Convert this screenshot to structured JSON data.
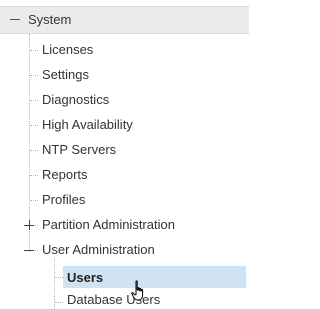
{
  "tree": {
    "root": {
      "label": "System",
      "expanded": true
    },
    "items": [
      {
        "label": "Licenses"
      },
      {
        "label": "Settings"
      },
      {
        "label": "Diagnostics"
      },
      {
        "label": "High Availability"
      },
      {
        "label": "NTP Servers"
      },
      {
        "label": "Reports"
      },
      {
        "label": "Profiles"
      },
      {
        "label": "Partition Administration",
        "expanded": false
      },
      {
        "label": "User Administration",
        "expanded": true
      }
    ],
    "sub_items": [
      {
        "label": "Users",
        "selected": true
      },
      {
        "label": "Database Users"
      }
    ]
  },
  "colors": {
    "header_bg": "#ebebeb",
    "selected_bg": "#cfe3f2",
    "text": "#333333",
    "guide_line": "#b8b8b8"
  },
  "icons": {
    "root_toggle": "minus-icon",
    "partition_toggle": "plus-icon",
    "user_admin_toggle": "minus-icon",
    "cursor": "hand-pointer-cursor-icon"
  }
}
